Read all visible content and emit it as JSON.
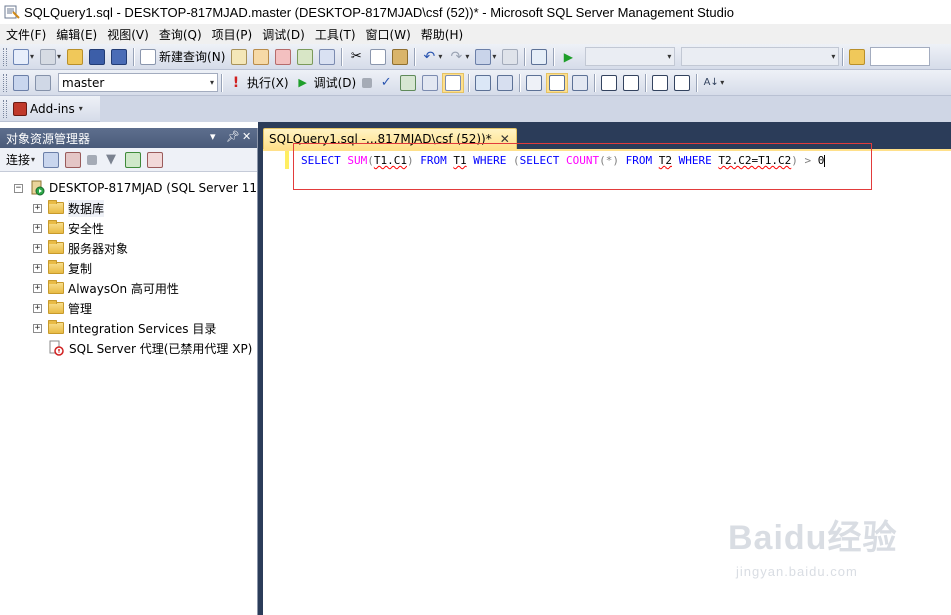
{
  "window": {
    "title": "SQLQuery1.sql - DESKTOP-817MJAD.master (DESKTOP-817MJAD\\csf (52))* - Microsoft SQL Server Management Studio"
  },
  "menu": [
    "文件(F)",
    "编辑(E)",
    "视图(V)",
    "查询(Q)",
    "项目(P)",
    "调试(D)",
    "工具(T)",
    "窗口(W)",
    "帮助(H)"
  ],
  "toolbar1": {
    "new_query_label": "新建查询(N)"
  },
  "toolbar2": {
    "database": "master",
    "execute_label": "执行(X)",
    "debug_label": "调试(D)"
  },
  "toolbar3": {
    "addins_label": "Add-ins"
  },
  "object_explorer": {
    "title": "对象资源管理器",
    "connect_label": "连接",
    "server": "DESKTOP-817MJAD (SQL Server 11",
    "nodes": [
      {
        "label": "数据库"
      },
      {
        "label": "安全性"
      },
      {
        "label": "服务器对象"
      },
      {
        "label": "复制"
      },
      {
        "label": "AlwaysOn 高可用性"
      },
      {
        "label": "管理"
      },
      {
        "label": "Integration Services 目录"
      }
    ],
    "agent": "SQL Server 代理(已禁用代理 XP)"
  },
  "editor": {
    "tab_title": "SQLQuery1.sql -...817MJAD\\csf (52))*",
    "code": {
      "t1": "SELECT",
      "t2": "SUM",
      "t3": "(",
      "t4": "T1.C1",
      "t5": ")",
      "t6": "FROM",
      "t7": "T1",
      "t8": "WHERE",
      "t9": "(",
      "t10": "SELECT",
      "t11": "COUNT",
      "t12": "(*)",
      "t13": "FROM",
      "t14": "T2",
      "t15": "WHERE",
      "t16": "T2.C2=T1.C2",
      "t17": ")",
      "t18": ">",
      "t19": "0"
    }
  },
  "watermark": {
    "logo": "Baidu经验",
    "site": "jingyan.baidu.com"
  },
  "colors": {
    "keyword": "#0000ff",
    "function": "#ff00ff",
    "doc_background": "#2b3c59",
    "tab_active": "#ffe08a",
    "highlight_box": "#e23b3b"
  }
}
